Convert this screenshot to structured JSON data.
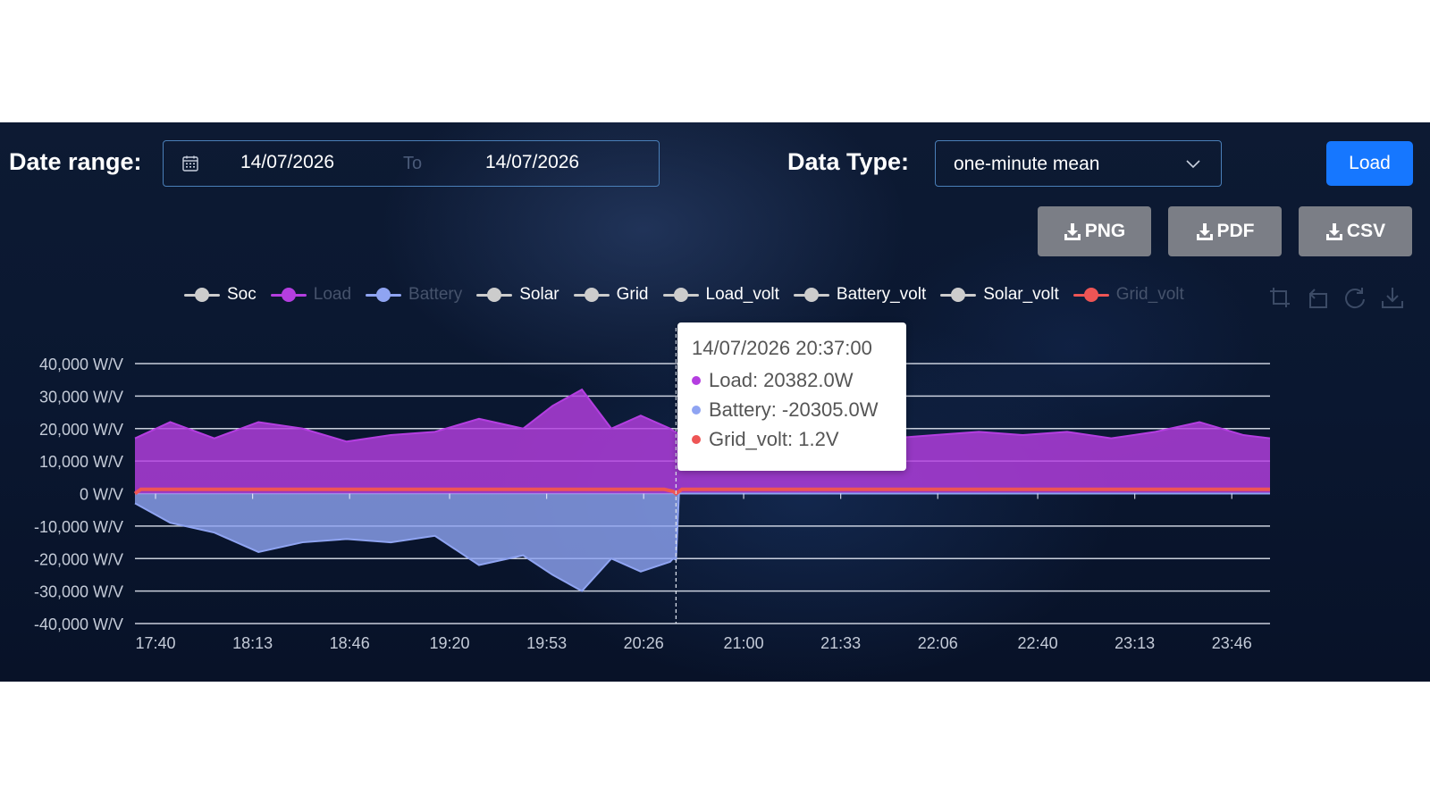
{
  "filters": {
    "date_range_label": "Date range:",
    "date_from": "14/07/2026",
    "date_sep": "To",
    "date_to": "14/07/2026",
    "data_type_label": "Data Type:",
    "data_type_value": "one-minute mean",
    "load_button": "Load"
  },
  "export": {
    "png": "PNG",
    "pdf": "PDF",
    "csv": "CSV"
  },
  "legend": [
    {
      "name": "Soc",
      "color": "#cccccc",
      "active": true
    },
    {
      "name": "Load",
      "color": "#b43ee0",
      "active": false
    },
    {
      "name": "Battery",
      "color": "#8fa4f2",
      "active": false
    },
    {
      "name": "Solar",
      "color": "#cccccc",
      "active": true
    },
    {
      "name": "Grid",
      "color": "#cccccc",
      "active": true
    },
    {
      "name": "Load_volt",
      "color": "#cccccc",
      "active": true
    },
    {
      "name": "Battery_volt",
      "color": "#cccccc",
      "active": true
    },
    {
      "name": "Solar_volt",
      "color": "#cccccc",
      "active": true
    },
    {
      "name": "Grid_volt",
      "color": "#ee5555",
      "active": false
    }
  ],
  "toolbox": [
    "zoom-icon",
    "zoom-reset-icon",
    "restore-icon",
    "save-image-icon"
  ],
  "tooltip": {
    "title": "14/07/2026 20:37:00",
    "rows": [
      {
        "text": "Load: 20382.0W",
        "color": "#b43ee0"
      },
      {
        "text": "Battery: -20305.0W",
        "color": "#8fa4f2"
      },
      {
        "text": "Grid_volt: 1.2V",
        "color": "#ee5555"
      }
    ]
  },
  "chart_data": {
    "type": "area",
    "y_unit": " W/V",
    "ylim": [
      -40000,
      40000
    ],
    "y_ticks": [
      40000,
      30000,
      20000,
      10000,
      0,
      -10000,
      -20000,
      -30000,
      -40000
    ],
    "y_tick_labels": [
      "40,000 W/V",
      "30,000 W/V",
      "20,000 W/V",
      "10,000 W/V",
      "0 W/V",
      "-10,000 W/V",
      "-20,000 W/V",
      "-30,000 W/V",
      "-40,000 W/V"
    ],
    "x_tick_labels": [
      "17:40",
      "18:13",
      "18:46",
      "19:20",
      "19:53",
      "20:26",
      "21:00",
      "21:33",
      "22:06",
      "22:40",
      "23:13",
      "23:46"
    ],
    "x_range": [
      "17:33",
      "23:59"
    ],
    "cursor_time": "20:37",
    "grid": true,
    "series": [
      {
        "name": "Load",
        "color": "#b43ee0",
        "x": [
          "17:33",
          "17:45",
          "18:00",
          "18:15",
          "18:30",
          "18:45",
          "19:00",
          "19:15",
          "19:30",
          "19:45",
          "19:55",
          "20:05",
          "20:15",
          "20:25",
          "20:35",
          "20:40",
          "20:50",
          "21:05",
          "21:20",
          "21:35",
          "21:50",
          "22:05",
          "22:20",
          "22:35",
          "22:50",
          "23:05",
          "23:20",
          "23:35",
          "23:50",
          "23:59"
        ],
        "values": [
          17000,
          22000,
          17000,
          22000,
          20000,
          16000,
          18000,
          19000,
          23000,
          20000,
          27000,
          32000,
          20000,
          24000,
          20000,
          17000,
          19000,
          18000,
          18000,
          19000,
          17000,
          18000,
          19000,
          18000,
          19000,
          17000,
          19000,
          22000,
          18000,
          17000
        ]
      },
      {
        "name": "Battery",
        "color": "#8fa4f2",
        "x": [
          "17:33",
          "17:45",
          "18:00",
          "18:15",
          "18:30",
          "18:45",
          "19:00",
          "19:15",
          "19:30",
          "19:45",
          "19:55",
          "20:05",
          "20:15",
          "20:25",
          "20:35",
          "20:36",
          "20:37",
          "20:38",
          "23:59"
        ],
        "values": [
          -3000,
          -9000,
          -12000,
          -18000,
          -15000,
          -14000,
          -15000,
          -13000,
          -22000,
          -19000,
          -25000,
          -30000,
          -20000,
          -24000,
          -21000,
          -20000,
          -20305,
          0,
          0
        ]
      },
      {
        "name": "Grid_volt",
        "color": "#ee5555",
        "x": [
          "17:33",
          "17:35",
          "20:33",
          "20:36",
          "20:37",
          "20:39",
          "23:59"
        ],
        "values": [
          0,
          1300,
          1300,
          700,
          1.2,
          1300,
          1300
        ]
      }
    ]
  }
}
